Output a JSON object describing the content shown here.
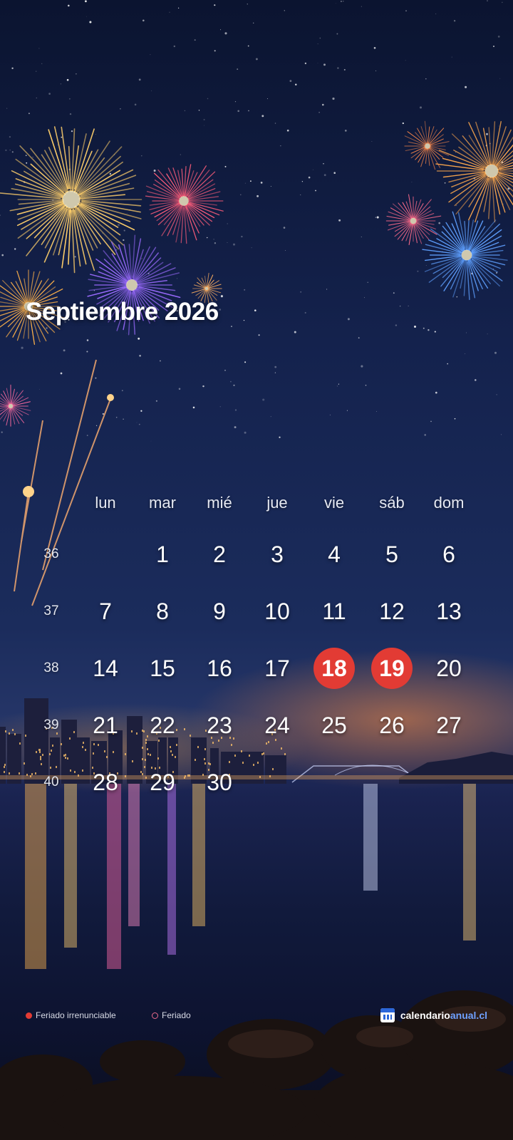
{
  "calendar": {
    "title": "Septiembre 2026",
    "weekdays": [
      "lun",
      "mar",
      "mié",
      "jue",
      "vie",
      "sáb",
      "dom"
    ],
    "weeks": [
      {
        "number": "36",
        "days": [
          "",
          "1",
          "2",
          "3",
          "4",
          "5",
          "6"
        ]
      },
      {
        "number": "37",
        "days": [
          "7",
          "8",
          "9",
          "10",
          "11",
          "12",
          "13"
        ]
      },
      {
        "number": "38",
        "days": [
          "14",
          "15",
          "16",
          "17",
          "18",
          "19",
          "20"
        ]
      },
      {
        "number": "39",
        "days": [
          "21",
          "22",
          "23",
          "24",
          "25",
          "26",
          "27"
        ]
      },
      {
        "number": "40",
        "days": [
          "28",
          "29",
          "30",
          "",
          "",
          "",
          ""
        ]
      }
    ],
    "holidays_irrenunciable": [
      "18",
      "19"
    ],
    "holiday_color": "#e23b34"
  },
  "legend": {
    "irrenunciable_label": "Feriado irrenunciable",
    "feriado_label": "Feriado"
  },
  "brand": {
    "name_part1": "calendario",
    "name_part2": "anual.cl",
    "icon": "calendar-icon"
  }
}
